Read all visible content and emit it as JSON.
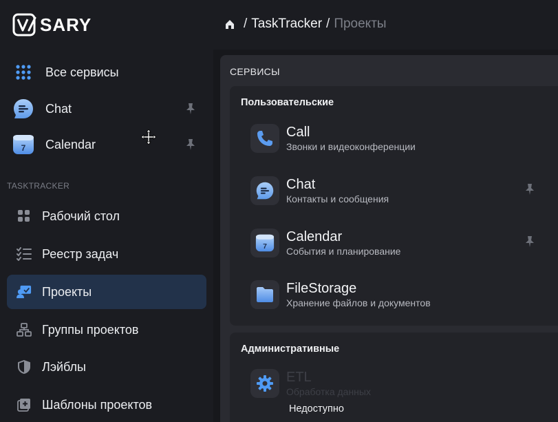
{
  "header": {
    "logo_text": "VISARY",
    "breadcrumb": [
      "TaskTracker",
      "Проекты"
    ]
  },
  "sidebar": {
    "services": [
      {
        "label": "Все сервисы",
        "icon": "grid-dots-icon",
        "pinned": false
      },
      {
        "label": "Chat",
        "icon": "chat-bubble-icon",
        "pinned": true
      },
      {
        "label": "Calendar",
        "icon": "calendar-icon",
        "pinned": true
      }
    ],
    "section_title": "TASKTRACKER",
    "nav": [
      {
        "label": "Рабочий стол",
        "icon": "dashboard-icon",
        "active": false
      },
      {
        "label": "Реестр задач",
        "icon": "task-list-icon",
        "active": false
      },
      {
        "label": "Проекты",
        "icon": "projects-icon",
        "active": true
      },
      {
        "label": "Группы проектов",
        "icon": "hierarchy-icon",
        "active": false
      },
      {
        "label": "Лэйблы",
        "icon": "shield-icon",
        "active": false
      },
      {
        "label": "Шаблоны проектов",
        "icon": "template-icon",
        "active": false
      }
    ]
  },
  "main": {
    "panel_title": "СЕРВИСЫ",
    "groups": [
      {
        "title": "Пользовательские",
        "items": [
          {
            "name": "Call",
            "desc": "Звонки и видеоконференции",
            "icon": "phone-icon",
            "pinned": false
          },
          {
            "name": "Chat",
            "desc": "Контакты и сообщения",
            "icon": "chat-bubble-icon",
            "pinned": true
          },
          {
            "name": "Calendar",
            "desc": "События и планирование",
            "icon": "calendar-icon",
            "pinned": true
          },
          {
            "name": "FileStorage",
            "desc": "Хранение файлов и документов",
            "icon": "folder-icon",
            "pinned": false
          }
        ]
      },
      {
        "title": "Административные",
        "items": [
          {
            "name": "ETL",
            "desc": "Обработка данных",
            "icon": "gear-icon",
            "pinned": false,
            "disabled": true
          }
        ],
        "status": "Недоступно"
      }
    ]
  },
  "calendar_day": "7",
  "colors": {
    "accent": "#4a90e2",
    "active_nav_bg": "#22324a",
    "sidebar_bg": "#1b1c21",
    "panel_bg": "#2a2b31"
  }
}
